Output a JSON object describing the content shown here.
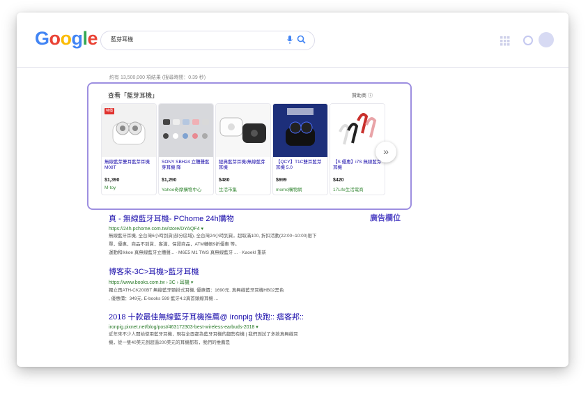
{
  "search": {
    "query": "藍芽耳機"
  },
  "result_stats": "約有 13,500,000 項結果 (搜尋時間：0.39 秒)",
  "shopping": {
    "title": "查看「藍芽耳機」",
    "sponsored": "贊助商 ⓘ",
    "next_icon": "double-chevron-right-icon",
    "sale_badge": "特價",
    "products": [
      {
        "name": "無線藍芽雙耳藍芽耳機 M08T",
        "price": "$1,390",
        "store": "M-toy"
      },
      {
        "name": "SONY SBH24 立體聲藍芽耳機 降",
        "price": "$1,290",
        "store": "Yahoo奇摩購物中心"
      },
      {
        "name": "經典藍芽耳機/無線藍芽耳機",
        "price": "$480",
        "store": "生活市集"
      },
      {
        "name": "【QCY】T1C雙耳藍芽耳機 5.0",
        "price": "$699",
        "store": "momo購物網"
      },
      {
        "name": "【S 優惠】i7S 無線藍芽耳機",
        "price": "$420",
        "store": "17Life生活電商"
      }
    ]
  },
  "ad_label": "廣告欄位",
  "results": [
    {
      "title": "真 - 無線藍牙耳機- PChome 24h購物",
      "url": "https://24h.pchome.com.tw/store/DYAQF4 ▾",
      "snippet_1": "無線藍牙耳機, 全台灣6小時到貨(部分區域), 全台灣24小時到貨，超取滿100, 折扣活動(22:00~10:00)限下",
      "snippet_2": "單，優惠，商品不到貨，客滿，保證商品，ATM轉帳9折優惠 等。",
      "links": "運動和Ikkoe 真無線藍牙立體聲... · M6E5 M1 TWS 真無線藍牙 ... · Kaoekl 重新"
    },
    {
      "title": "博客來-3C>耳機>藍牙耳機",
      "url": "https://www.books.com.tw › 3C › 耳機 ▾",
      "snippet_1": "獨立再ATH-CK200BT 無線藍牙頸掛式耳機, 優惠價：1690元. 真無線藍牙耳機HB02黑色",
      "snippet_2": ", 優惠價：349元. E-books 599 藍牙4.2真首頭線耳機 ..."
    },
    {
      "title": "2018 十款最佳無線藍牙耳機推薦@ ironpig 快跑:: 痞客邦::",
      "url": "ironpig.pixnet.net/blog/post/463172303-best-wireless-earbuds-2018 ▾",
      "snippet_1": "近年來不少人開始使用藍牙耳機，現在全面都為藍牙耳機的趨勢有機 | 我們測試了多款真無線耳",
      "snippet_2": "機，從一隻40美元到超過200美元的耳機都有，我們的推薦是"
    }
  ],
  "colors": {
    "accent_border": "#9d8fe0",
    "link": "#1a0dab",
    "url": "#2a7a2a"
  }
}
